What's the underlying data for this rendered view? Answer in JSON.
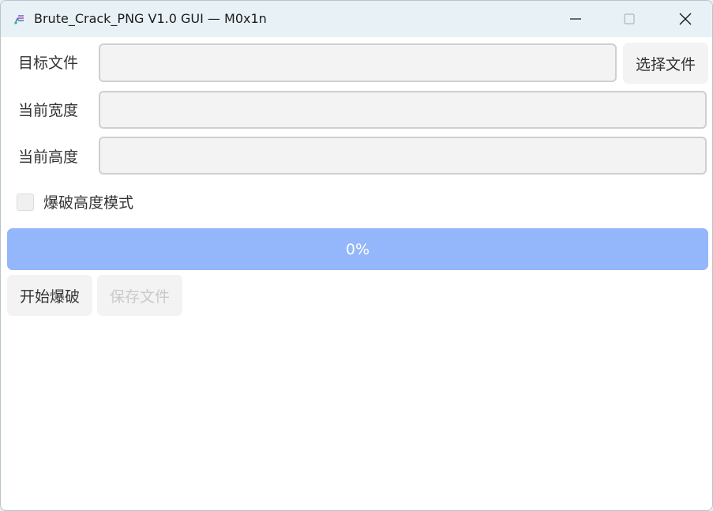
{
  "window": {
    "title": "Brute_Crack_PNG V1.0 GUI — M0x1n"
  },
  "form": {
    "target_file_label": "目标文件",
    "target_file_value": "",
    "choose_file_label": "选择文件",
    "current_width_label": "当前宽度",
    "current_width_value": "",
    "current_height_label": "当前高度",
    "current_height_value": "",
    "brute_height_mode_label": "爆破高度模式",
    "brute_height_mode_checked": false
  },
  "progress": {
    "value": 0,
    "text": "0%",
    "bar_color": "#94b6fb"
  },
  "actions": {
    "start_label": "开始爆破",
    "save_label": "保存文件",
    "save_disabled": true
  },
  "icons": {
    "app": "app-icon",
    "minimize": "minimize-icon",
    "maximize": "maximize-icon",
    "close": "close-icon"
  }
}
